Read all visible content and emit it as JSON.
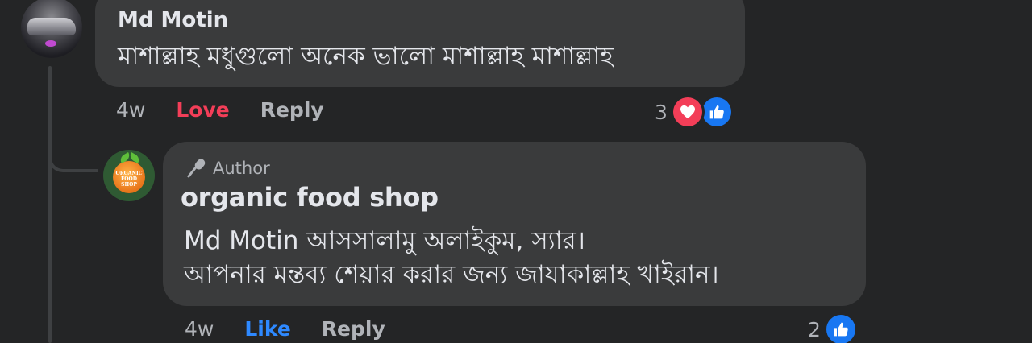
{
  "comment": {
    "author": "Md Motin",
    "text": "মাশাল্লাহ মধুগুলো অনেক ভালো মাশাল্লাহ মাশাল্লাহ",
    "time": "4w",
    "reaction_label": "Love",
    "reply_label": "Reply",
    "reaction_count": "3",
    "reaction_icons": [
      "heart-icon",
      "thumbs-up-icon"
    ]
  },
  "reply": {
    "badge": "Author",
    "author": "organic food shop",
    "avatar_logo_text": "ORGANIC FOOD SHOP",
    "lines": [
      "Md Motin আসসালামু অলাইকুম, স্যার।",
      "আপনার মন্তব্য শেয়ার করার জন্য জাযাকাল্লাহ খাইরান।"
    ],
    "time": "4w",
    "like_label": "Like",
    "reply_label": "Reply",
    "reaction_count": "2",
    "reaction_icons": [
      "thumbs-up-icon"
    ]
  },
  "colors": {
    "background": "#242526",
    "bubble": "#3a3b3c",
    "text": "#e4e6eb",
    "muted": "#b0b3b8",
    "love": "#f33e58",
    "like": "#1877f2"
  }
}
